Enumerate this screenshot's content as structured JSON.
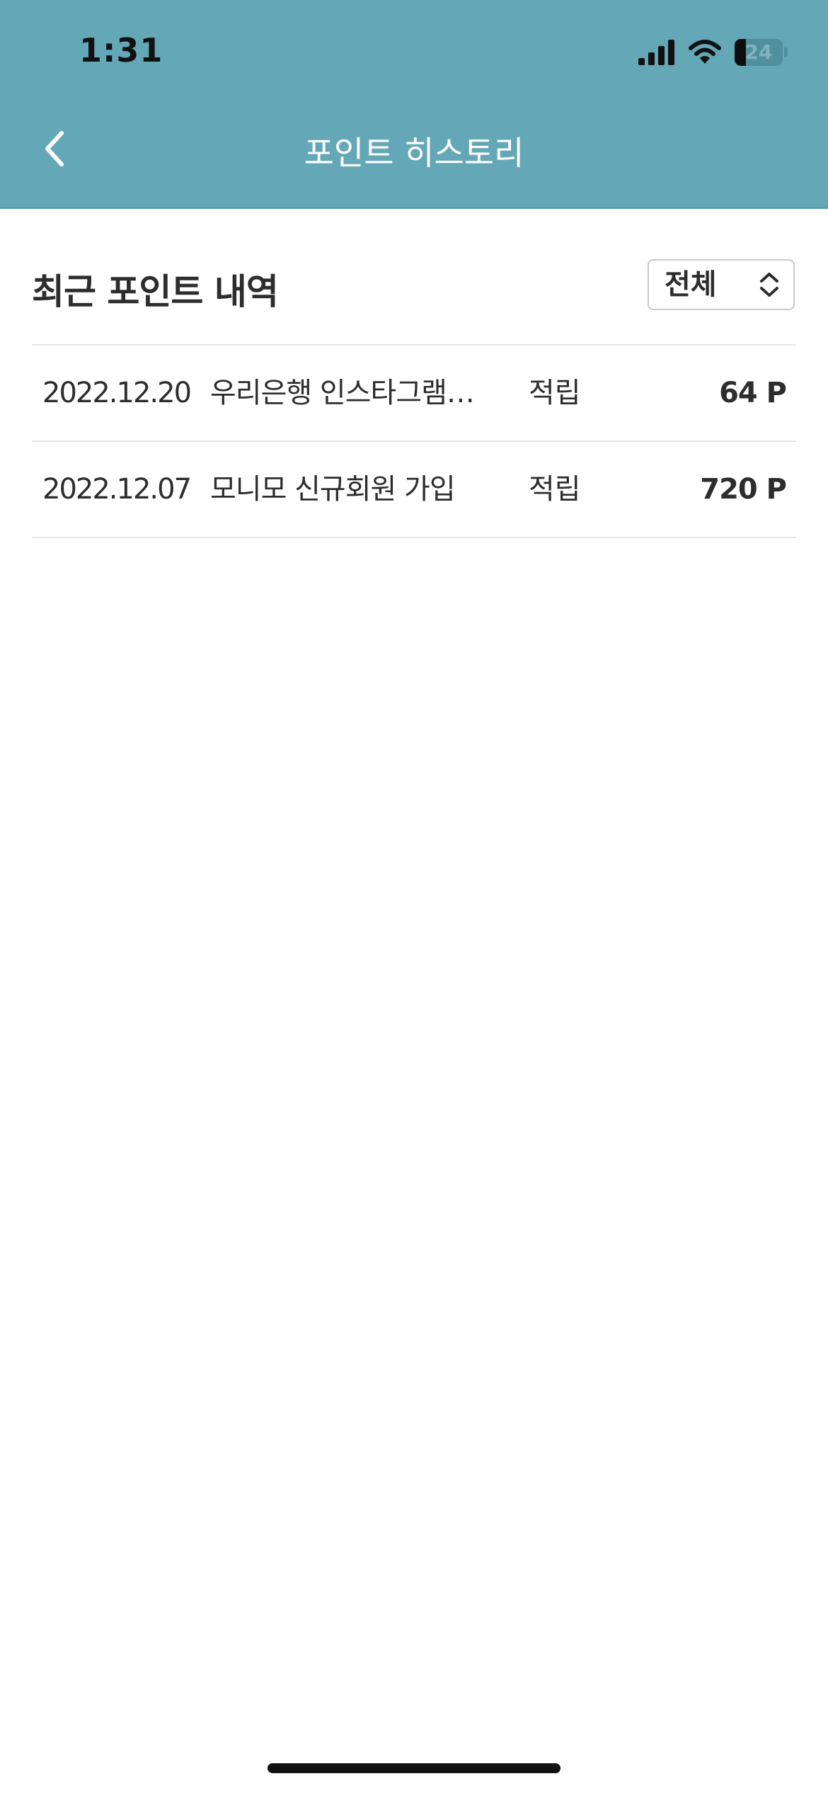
{
  "status_bar": {
    "time": "1:31",
    "battery_text": "24",
    "battery_level": 0.24,
    "icons": [
      "cellular-signal-icon",
      "wifi-icon",
      "battery-icon"
    ]
  },
  "nav": {
    "title": "포인트 히스토리",
    "back_icon": "chevron-left-icon"
  },
  "section": {
    "title": "최근 포인트 내역"
  },
  "filter": {
    "selected": "전체",
    "icon": "up-down-chevron-icon"
  },
  "history": [
    {
      "date": "2022.12.20",
      "description": "우리은행 인스타그램 …",
      "type": "적립",
      "points": "64 P"
    },
    {
      "date": "2022.12.07",
      "description": "모니모 신규회원 가입",
      "type": "적립",
      "points": "720 P"
    }
  ],
  "colors": {
    "header_background": "#64a7b7",
    "text_primary": "#2d2d2d",
    "divider": "#e5e5e5"
  }
}
